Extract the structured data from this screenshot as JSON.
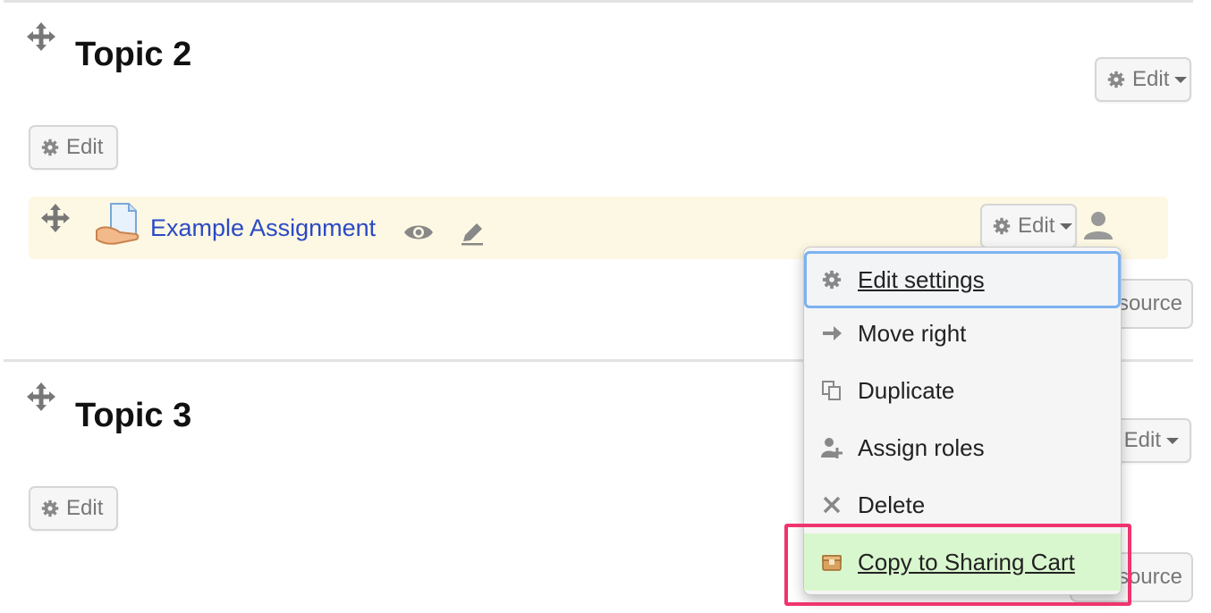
{
  "topics": [
    {
      "title": "Topic 2",
      "summary_edit_label": "Edit",
      "section_edit_label": "Edit"
    },
    {
      "title": "Topic 3",
      "summary_edit_label": "Edit",
      "section_edit_label": "Edit"
    }
  ],
  "activity": {
    "name": "Example Assignment",
    "edit_label": "Edit",
    "add_resource_partial": "source"
  },
  "bottom_partial": "source",
  "edit_menu": {
    "items": [
      {
        "label": "Edit settings",
        "icon": "gear-icon"
      },
      {
        "label": "Move right",
        "icon": "arrow-right-icon"
      },
      {
        "label": "Duplicate",
        "icon": "duplicate-icon"
      },
      {
        "label": "Assign roles",
        "icon": "assign-roles-icon"
      },
      {
        "label": "Delete",
        "icon": "close-icon"
      },
      {
        "label": "Copy to Sharing Cart",
        "icon": "box-icon"
      }
    ]
  },
  "colors": {
    "link": "#2b49c4",
    "activity_highlight": "#fdf8e3",
    "menu_item_highlight": "#d9f7ce",
    "annotation_box": "#f0346e",
    "focus_ring": "#7db2f0"
  }
}
